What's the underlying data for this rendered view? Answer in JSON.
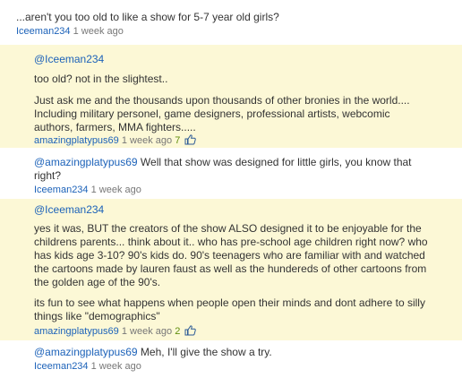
{
  "comments": [
    {
      "text": "...aren't you too old to like a show for 5-7 year old girls?",
      "author": "Iceeman234",
      "time": "1 week ago"
    },
    {
      "mention": "@Iceeman234",
      "paragraphs": [
        "too old? not in the slightest..",
        "Just ask me and the thousands upon thousands of other bronies in the world.... Including military personel, game designers, professional artists, webcomic authors, farmers, MMA fighters.....",
        ""
      ],
      "author": "amazingplatypus69",
      "time": "1 week ago",
      "votes": "7"
    },
    {
      "mention": "@amazingplatypus69",
      "text": " Well that show was designed for little girls, you know that right?",
      "author": "Iceeman234",
      "time": "1 week ago"
    },
    {
      "mention": "@Iceeman234",
      "paragraphs": [
        "yes it was, BUT the creators of the show ALSO designed it to be enjoyable for the childrens parents... think about it.. who has pre-school age children right now? who has kids age 3-10? 90's kids do. 90's teenagers who are familiar with and watched the cartoons made by lauren faust as well as the hundereds of other cartoons from the golden age of the 90's.",
        "its fun to see what happens when people open their minds and dont adhere to silly things like \"demographics\""
      ],
      "author": "amazingplatypus69",
      "time": "1 week ago",
      "votes": "2"
    },
    {
      "mention": "@amazingplatypus69",
      "text": " Meh, I'll give the show a try.",
      "author": "Iceeman234",
      "time": "1 week ago"
    }
  ],
  "colors": {
    "link": "#1c62b9",
    "reply_background": "#fcf8d6",
    "vote_green": "#5f8d0c"
  },
  "icons": {
    "like": "thumbs-up-icon"
  }
}
